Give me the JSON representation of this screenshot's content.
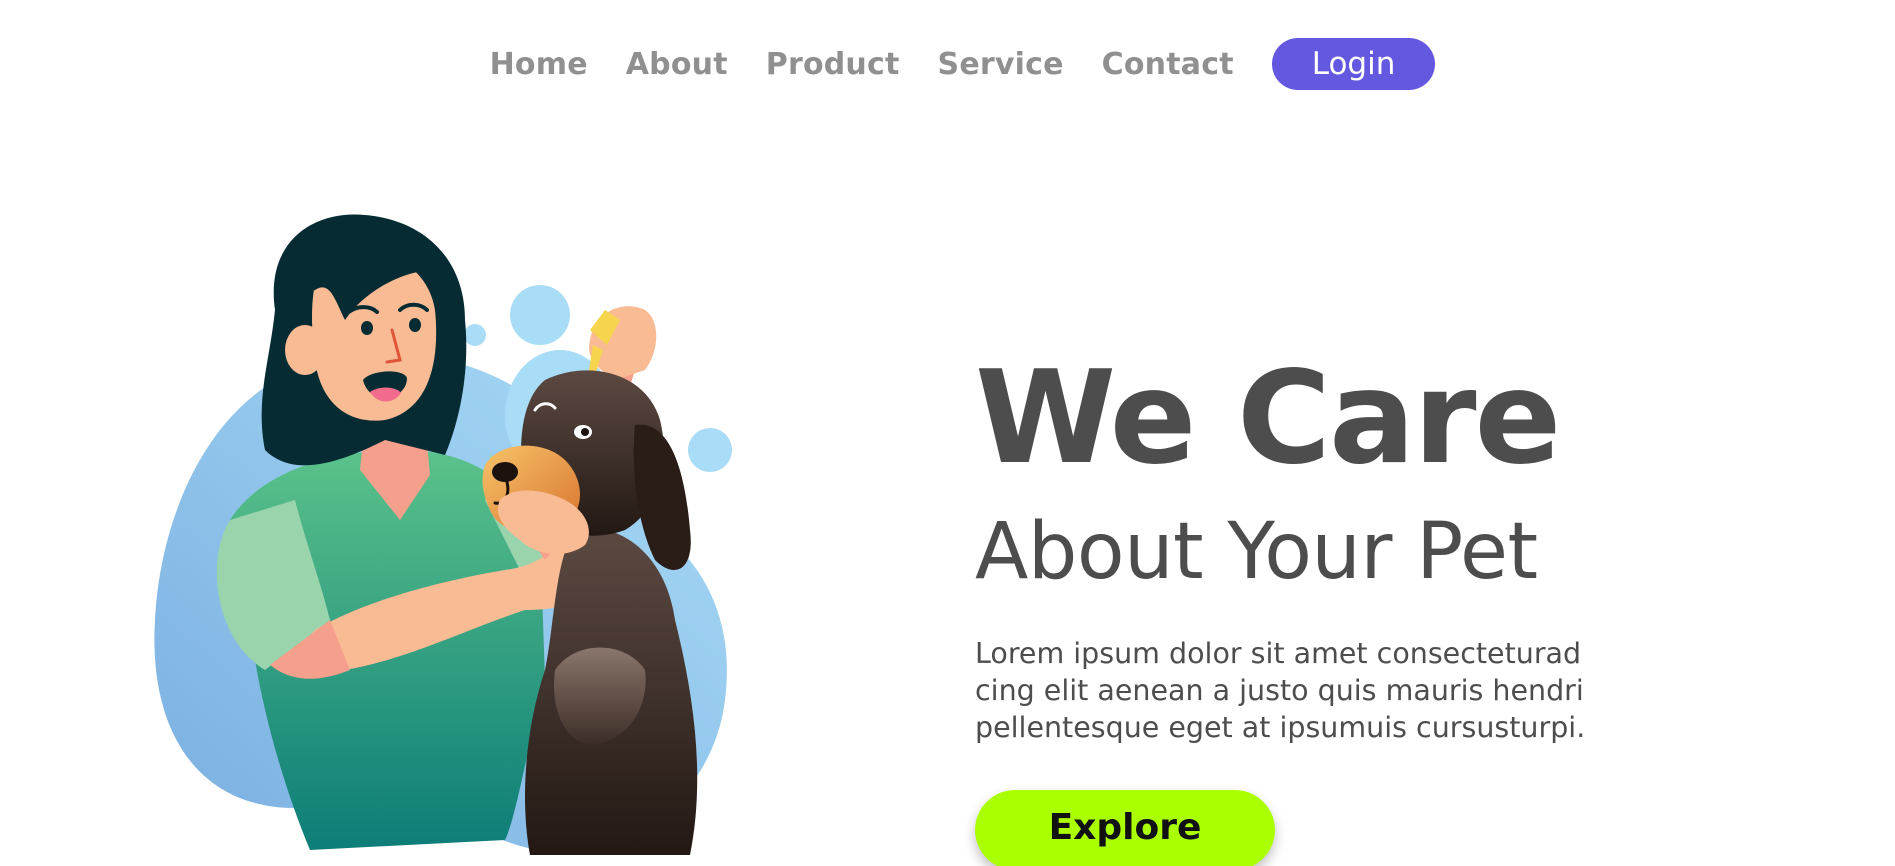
{
  "nav": {
    "links": [
      {
        "label": "Home"
      },
      {
        "label": "About"
      },
      {
        "label": "Product"
      },
      {
        "label": "Service"
      },
      {
        "label": "Contact"
      }
    ],
    "login_label": "Login"
  },
  "hero": {
    "title": "We Care",
    "subtitle": "About Your Pet",
    "description_lines": [
      "Lorem ipsum dolor sit amet consecteturad",
      "cing elit aenean a justo quis mauris hendri",
      "pellentesque eget at ipsumuis cursusturpi."
    ],
    "explore_label": "Explore"
  },
  "colors": {
    "accent": "#6558e0",
    "cta": "#aaff00",
    "heading": "#4d4d4d",
    "nav_text": "#909090",
    "blob": "#9fd3f2"
  },
  "illustration": {
    "icon": "woman-giving-dog-eye-drops-illustration"
  }
}
